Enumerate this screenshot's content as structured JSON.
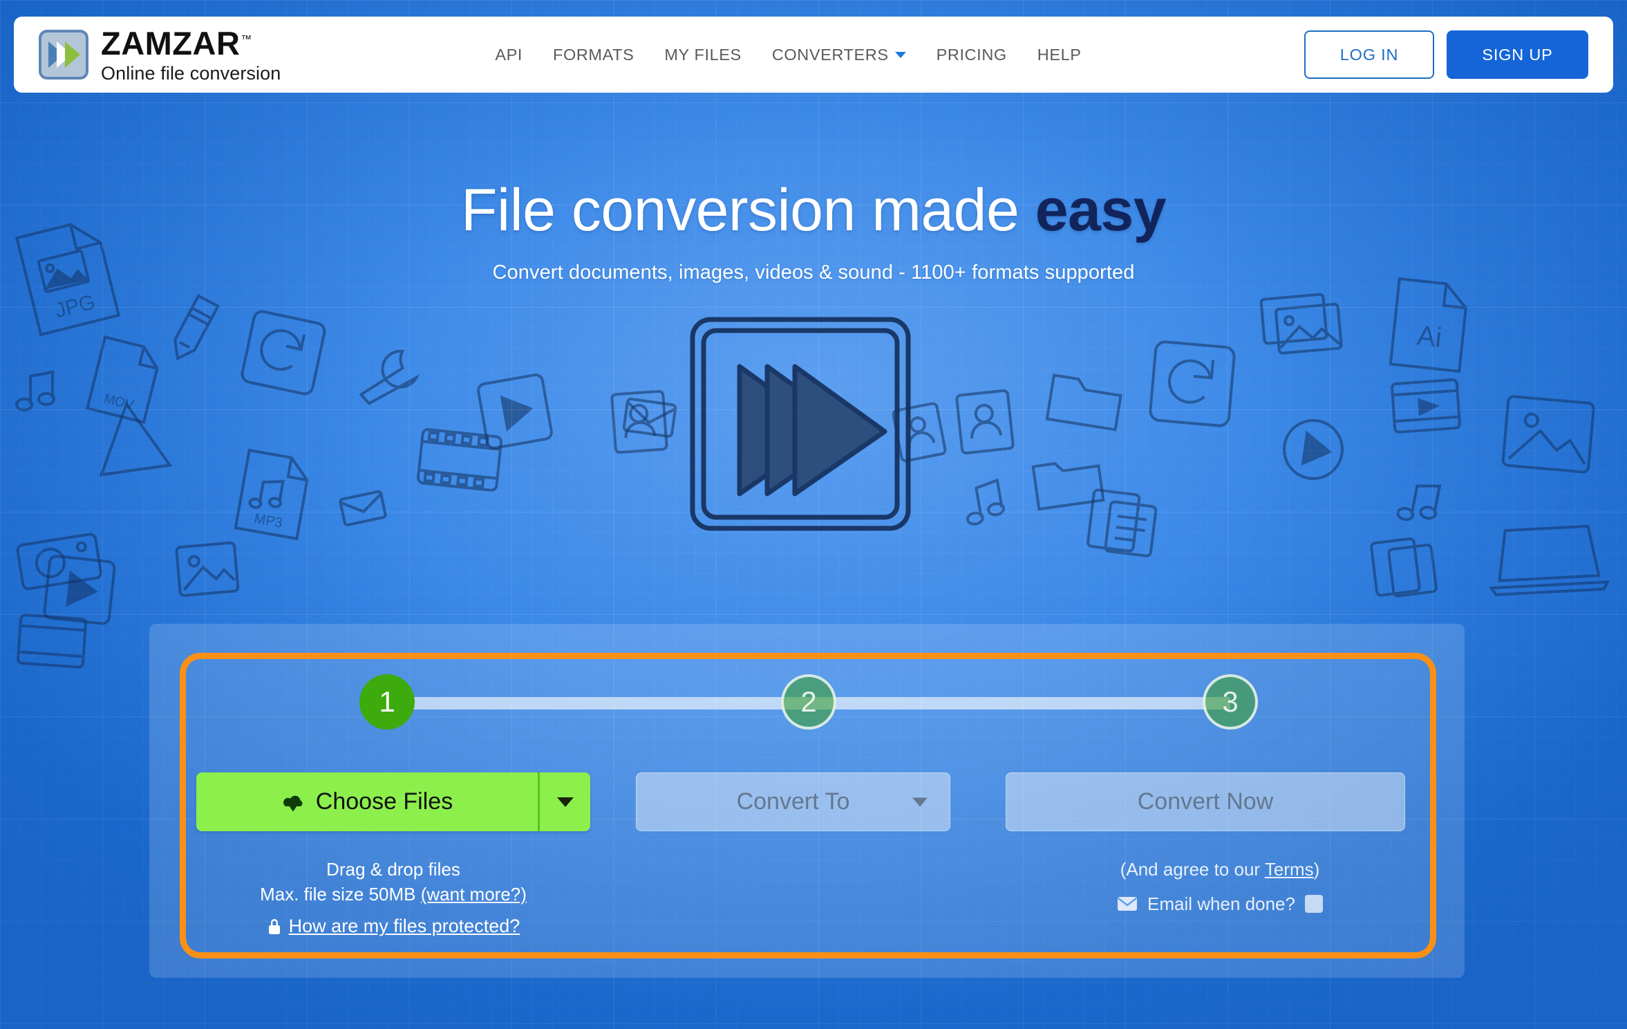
{
  "header": {
    "logo": {
      "wordmark": "ZAMZAR",
      "trademark": "™",
      "tagline": "Online file conversion",
      "icon": "double-chevron-logo"
    },
    "nav": [
      {
        "label": "API",
        "has_caret": false
      },
      {
        "label": "FORMATS",
        "has_caret": false
      },
      {
        "label": "MY FILES",
        "has_caret": false
      },
      {
        "label": "CONVERTERS",
        "has_caret": true
      },
      {
        "label": "PRICING",
        "has_caret": false
      },
      {
        "label": "HELP",
        "has_caret": false
      }
    ],
    "login_label": "LOG IN",
    "signup_label": "SIGN UP"
  },
  "hero": {
    "headline_plain": "File conversion made ",
    "headline_accent": "easy",
    "subtitle": "Convert documents, images, videos & sound - 1100+ formats supported",
    "illustration": "fast-forward-sketch-icon"
  },
  "converter": {
    "steps": [
      {
        "number": "1",
        "state": "active"
      },
      {
        "number": "2",
        "state": "inactive"
      },
      {
        "number": "3",
        "state": "inactive"
      }
    ],
    "choose_files_label": "Choose Files",
    "choose_files_icon": "cloud-upload-icon",
    "convert_to_label": "Convert To",
    "convert_now_label": "Convert Now",
    "drag_drop_text": "Drag & drop files",
    "max_size_prefix": "Max. file size 50MB ",
    "want_more_link": "(want more?)",
    "protected_link": "How are my files protected?",
    "protected_icon": "lock-icon",
    "terms_prefix": "(And agree to our ",
    "terms_link": "Terms",
    "terms_suffix": ")",
    "email_label": "Email when done?",
    "email_icon": "envelope-icon",
    "email_checked": false
  },
  "colors": {
    "page_blue": "#3d8ae8",
    "header_white": "#ffffff",
    "nav_grey": "#5a5a5a",
    "caret_blue": "#1c7ae0",
    "login_border": "#1c6fc4",
    "signup_bg": "#1565d8",
    "headline_white": "#ffffff",
    "headline_accent_navy": "#11255c",
    "highlight_orange": "#fa9016",
    "step_active_green": "#3daa0d",
    "choose_files_green": "#8cef4c",
    "ghost_text_grey": "#64778f",
    "logo_icon_border": "#5d87b5",
    "logo_icon_fill": "#b3c6d8",
    "logo_chevron_blue": "#4a7fb5",
    "logo_chevron_green": "#8cbf3f"
  }
}
